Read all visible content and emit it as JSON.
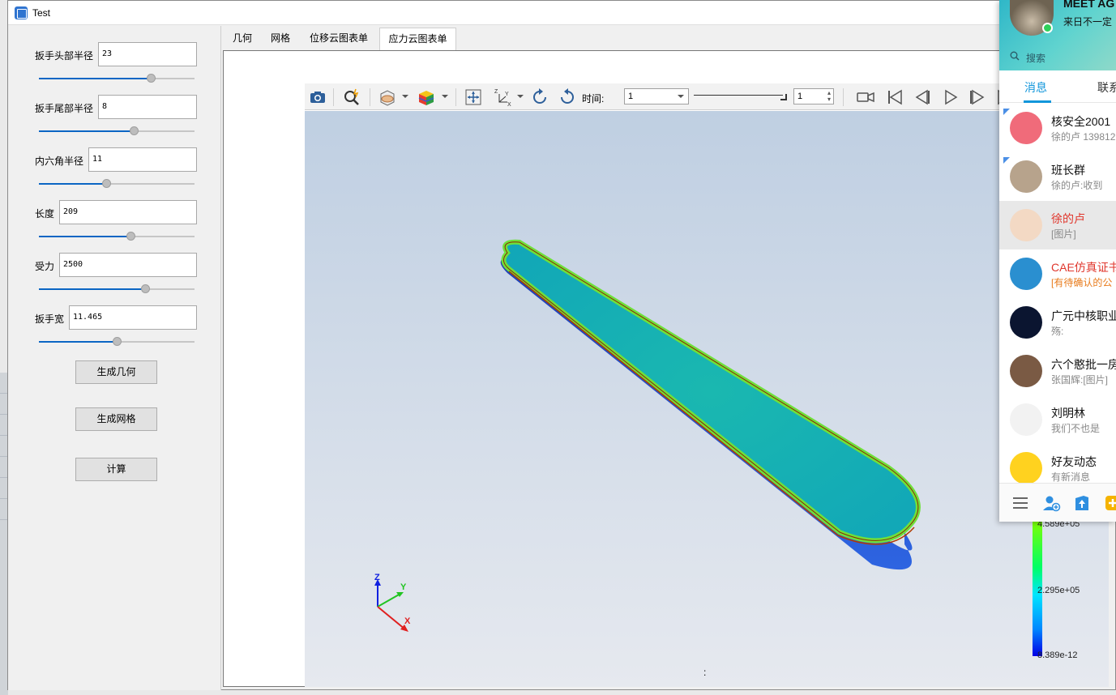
{
  "window": {
    "title": "Test"
  },
  "params": [
    {
      "label": "扳手头部半径",
      "value": "23",
      "slider": 0.72
    },
    {
      "label": "扳手尾部半径",
      "value": "8",
      "slider": 0.61
    },
    {
      "label": "内六角半径",
      "value": "11",
      "slider": 0.43
    },
    {
      "label": "长度",
      "value": "209",
      "slider": 0.59
    },
    {
      "label": "受力",
      "value": "2500",
      "slider": 0.68
    },
    {
      "label": "扳手宽",
      "value": "11.465",
      "slider": 0.5
    }
  ],
  "buttons": {
    "geometry": "生成几何",
    "mesh": "生成网格",
    "compute": "计算"
  },
  "tabs": [
    "几何",
    "网格",
    "位移云图表单",
    "应力云图表单"
  ],
  "active_tab": 3,
  "viewer": {
    "time_label": "时间:",
    "time_value": "1",
    "step_value": "1",
    "colorbar": {
      "max_label": "4.589e+05",
      "mid_label": "2.295e+05",
      "min_label": "8.389e-12"
    },
    "axes": {
      "x": "X",
      "y": "Y",
      "z": "Z"
    },
    "footer": ":"
  },
  "qq": {
    "name": "MEET AG",
    "signature": "来日不一定",
    "search": "搜索",
    "tabs": [
      "消息",
      "联系"
    ],
    "conversations": [
      {
        "name": "核安全2001",
        "preview": "徐的卢 139812",
        "color": "#f06b7a",
        "pinned": true
      },
      {
        "name": "班长群",
        "preview": "徐的卢:收到",
        "color": "#b7a38c",
        "pinned": true
      },
      {
        "name": "徐的卢",
        "preview": "[图片]",
        "color": "#f3d9c4",
        "selected": true,
        "name_color": "#e0362c"
      },
      {
        "name": "CAE仿真证书",
        "preview": "[有待确认的公",
        "color": "#2a8fd0",
        "name_color": "#e0362c",
        "preview_color": "#e87a1a"
      },
      {
        "name": "广元中核职业",
        "preview": "殇:",
        "color": "#0b1530"
      },
      {
        "name": "六个憨批一房",
        "preview": "张国辉:[图片]",
        "color": "#7a5a44"
      },
      {
        "name": "刘明林",
        "preview": "我们不也是",
        "color": "#f2f2f2"
      },
      {
        "name": "好友动态",
        "preview": "有新消息",
        "color": "#ffd21f"
      }
    ]
  }
}
